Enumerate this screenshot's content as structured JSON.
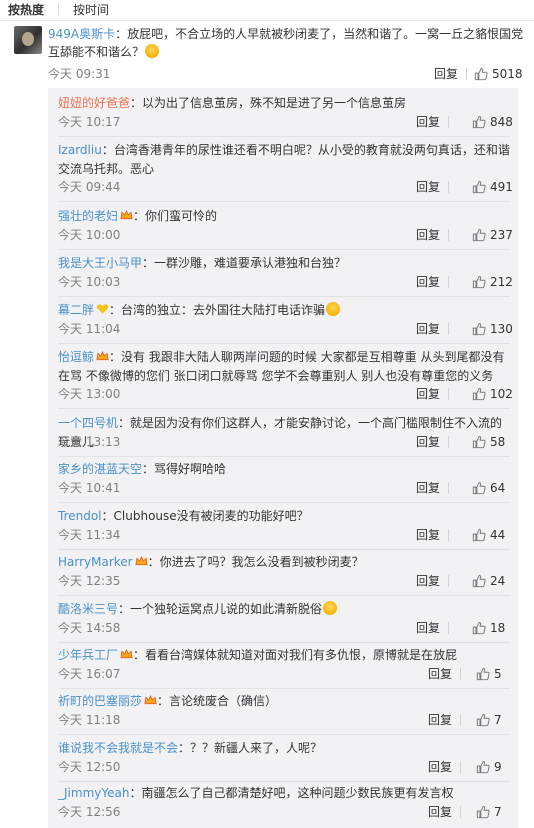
{
  "tabs": [
    "按热度",
    "按时间"
  ],
  "main": {
    "user": "949A奥斯卡",
    "text": "：放屁吧，不合立场的人早就被秒闭麦了，当然和谐了。一窝一丘之貉恨国党互舔能不和谐么？",
    "time": "今天 09:31",
    "reply": "回复",
    "likes": "5018"
  },
  "replies": [
    {
      "user": "妞妞的好爸爸",
      "user_color": "orange",
      "text": "：以为出了信息茧房，殊不知是进了另一个信息茧房",
      "time": "今天 10:17",
      "reply": "回复",
      "likes": "848"
    },
    {
      "user": "Izardliu",
      "user_color": "blue",
      "text": "：台湾香港青年的尿性谁还看不明白呢？从小受的教育就没两句真话，还和谐交流乌托邦。恶心",
      "time": "今天 09:44",
      "reply": "回复",
      "likes": "491"
    },
    {
      "user": "强壮的老妇",
      "user_color": "blue",
      "badge": true,
      "text": "：你们蛮可怜的",
      "time": "今天 10:00",
      "reply": "回复",
      "likes": "237"
    },
    {
      "user": "我是大王小马甲",
      "user_color": "blue",
      "text": "：一群沙雕，难道要承认港独和台独？",
      "time": "今天 10:03",
      "reply": "回复",
      "likes": "212"
    },
    {
      "user": "幕二胖",
      "user_color": "blue",
      "heart": true,
      "text": "：台湾的独立：去外国往大陆打电话诈骗",
      "emoji_end": true,
      "time": "今天 11:04",
      "reply": "回复",
      "likes": "130"
    },
    {
      "user": "怡逗鲸",
      "user_color": "blue",
      "badge": true,
      "text": "：没有 我跟非大陆人聊两岸问题的时候 大家都是互相尊重 从头到尾都没有在骂 不像微博的您们 张口闭口就辱骂 您学不会尊重别人 别人也没有尊重您的义务",
      "time": "今天 13:00",
      "reply": "回复",
      "likes": "102"
    },
    {
      "user": "一个四号机",
      "user_color": "blue",
      "text": "：就是因为没有你们这群人，才能安静讨论，一个高门槛限制住不入流的玩意儿",
      "time": "今天 13:13",
      "reply": "回复",
      "likes": "58"
    },
    {
      "user": "家乡的湛蓝天空",
      "user_color": "blue",
      "text": "：骂得好啊哈哈",
      "time": "今天 10:41",
      "reply": "回复",
      "likes": "64"
    },
    {
      "user": "Trendol",
      "user_color": "blue",
      "text": "：Clubhouse没有被闭麦的功能好吧？",
      "time": "今天 11:34",
      "reply": "回复",
      "likes": "44"
    },
    {
      "user": "HarryMarker",
      "user_color": "blue",
      "badge": true,
      "text": "：你进去了吗？我怎么没看到被秒闭麦？",
      "time": "今天 12:35",
      "reply": "回复",
      "likes": "24"
    },
    {
      "user": "酷洛米三号",
      "user_color": "blue",
      "text": "：一个独轮运窝点儿说的如此清新脱俗",
      "emoji_end": true,
      "time": "今天 14:58",
      "reply": "回复",
      "likes": "18"
    },
    {
      "user": "少年兵工厂",
      "user_color": "blue",
      "badge": true,
      "text": "：看看台湾媒体就知道对面对我们有多仇恨，原博就是在放屁",
      "time": "今天 16:07",
      "reply": "回复",
      "likes": "5"
    },
    {
      "user": "祈町的巴塞丽莎",
      "user_color": "blue",
      "badge": true,
      "text": "：言论统废合（确信）",
      "time": "今天 11:18",
      "reply": "回复",
      "likes": "7"
    },
    {
      "user": "谁说我不会我就是不会",
      "user_color": "blue",
      "text": "：？？新疆人来了，人呢？",
      "time": "今天 12:50",
      "reply": "回复",
      "likes": "9"
    },
    {
      "user": "_JimmyYeah",
      "user_color": "blue",
      "text": "：南疆怎么了自己都清楚好吧，这种问题少数民族更有发言权",
      "time": "今天 12:56",
      "reply": "回复",
      "likes": "7"
    }
  ],
  "colors": {
    "username_orange": "#eb7350",
    "username_blue": "#4a90c8",
    "meta_gray": "#808080",
    "sub_bg": "#f2f2f5"
  },
  "icons": {
    "like": "thumbs-up-icon",
    "badge": "vip-crown-icon",
    "heart": "heart-icon",
    "emoji": "emoji-face-icon"
  }
}
